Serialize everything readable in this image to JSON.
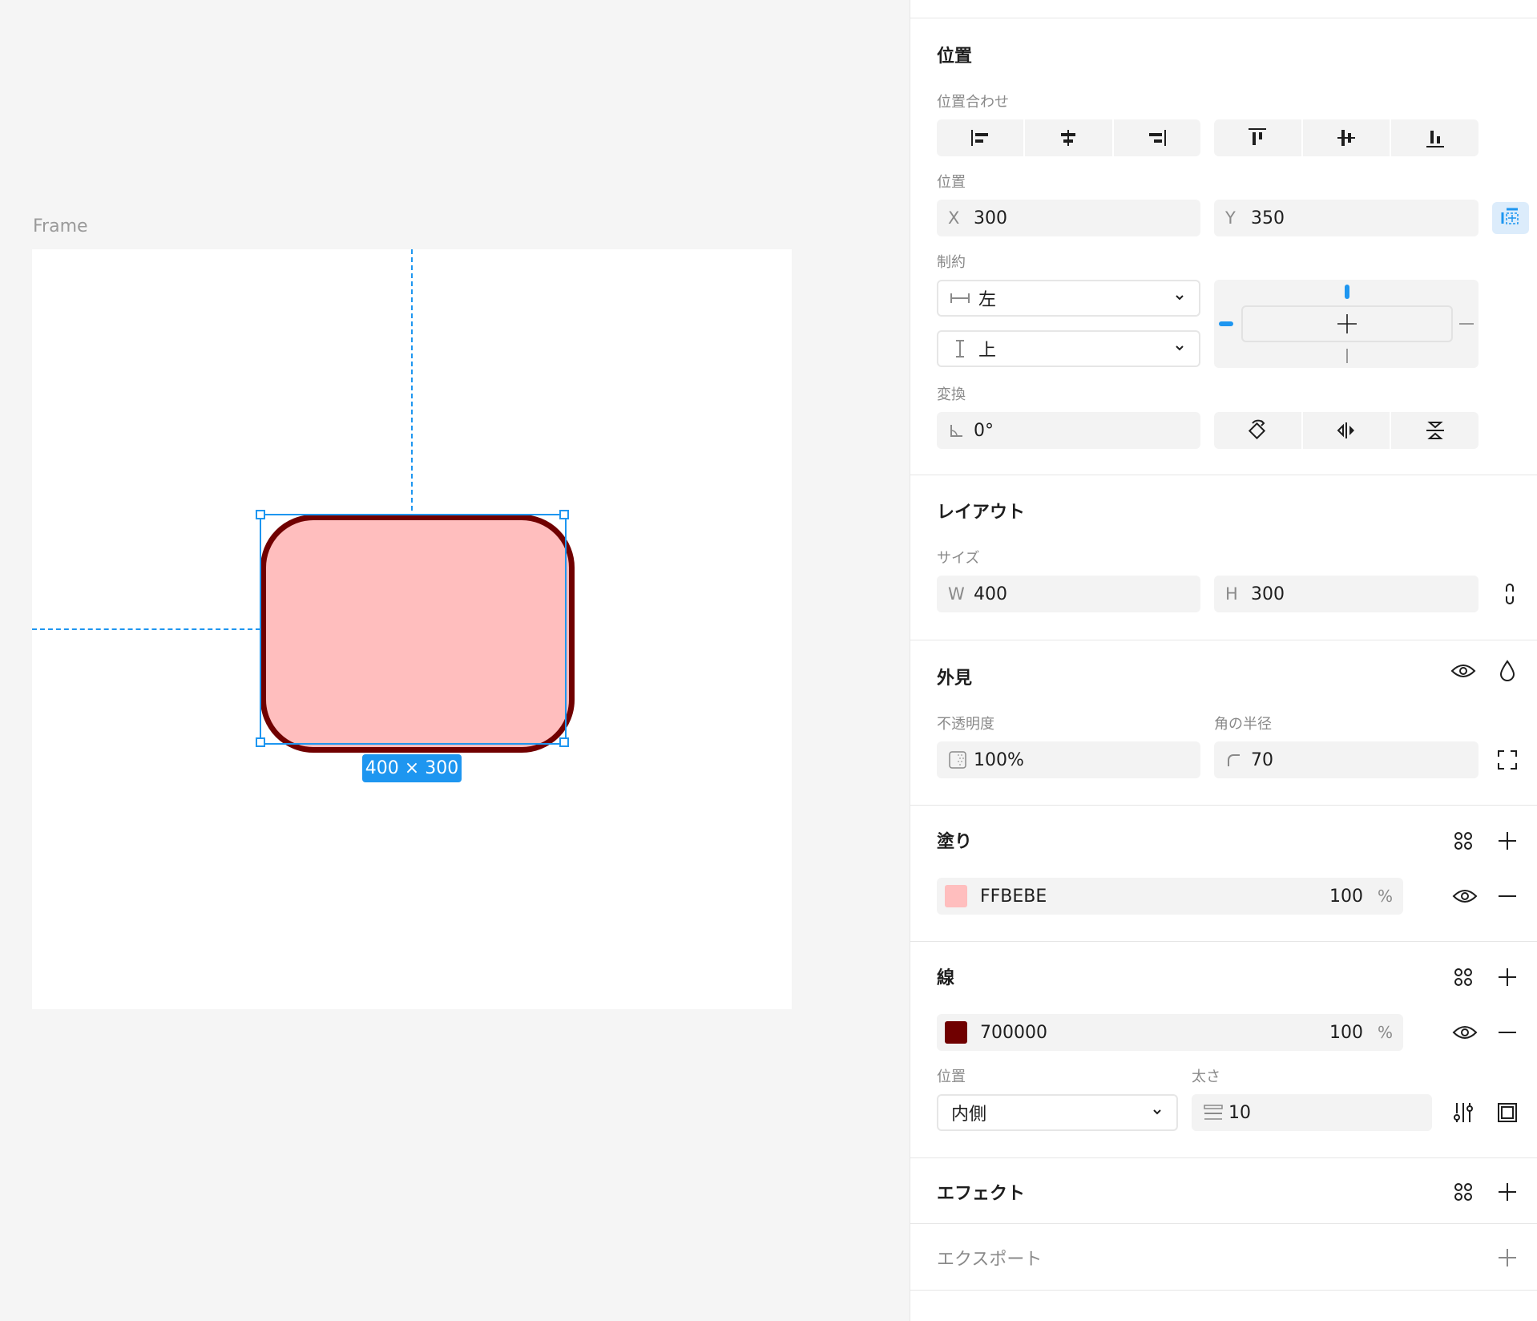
{
  "canvas": {
    "frame_label": "Frame",
    "size_badge": "400 × 300",
    "shape": {
      "fill": "#FFBEBE",
      "stroke": "#700000"
    },
    "accent": "#1E96F0"
  },
  "position": {
    "title": "位置",
    "align_label": "位置合わせ",
    "pos_label": "位置",
    "x_prefix": "X",
    "x": "300",
    "y_prefix": "Y",
    "y": "350",
    "constraints_label": "制約",
    "constraint_h": "左",
    "constraint_v": "上",
    "transform_label": "変換",
    "rotation": "0°"
  },
  "layout": {
    "title": "レイアウト",
    "size_label": "サイズ",
    "w_prefix": "W",
    "w": "400",
    "h_prefix": "H",
    "h": "300"
  },
  "appearance": {
    "title": "外見",
    "opacity_label": "不透明度",
    "opacity": "100%",
    "radius_label": "角の半径",
    "radius": "70"
  },
  "fill": {
    "title": "塗り",
    "color_hex": "FFBEBE",
    "swatch": "#FFBEBE",
    "opacity": "100",
    "percent": "%"
  },
  "stroke": {
    "title": "線",
    "color_hex": "700000",
    "swatch": "#700000",
    "opacity": "100",
    "percent": "%",
    "position_label": "位置",
    "position": "内側",
    "weight_label": "太さ",
    "weight": "10"
  },
  "effects": {
    "title": "エフェクト"
  },
  "export": {
    "title": "エクスポート"
  }
}
